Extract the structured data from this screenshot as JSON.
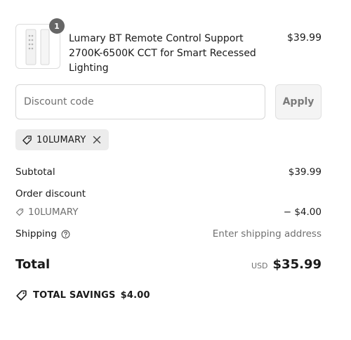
{
  "product": {
    "quantity": "1",
    "title": "Lumary BT Remote Control Support 2700K-6500K CCT for Smart Recessed Lighting",
    "price": "$39.99",
    "image_icon": "remote-control-product-image"
  },
  "discount": {
    "placeholder": "Discount code",
    "apply_label": "Apply",
    "applied_code": "10LUMARY"
  },
  "summary": {
    "subtotal_label": "Subtotal",
    "subtotal_value": "$39.99",
    "order_discount_label": "Order discount",
    "order_discount_code": "10LUMARY",
    "order_discount_value": "− $4.00",
    "shipping_label": "Shipping",
    "shipping_value": "Enter shipping address",
    "total_label": "Total",
    "currency": "USD",
    "total_value": "$35.99",
    "savings_label": "TOTAL SAVINGS",
    "savings_value": "$4.00"
  }
}
